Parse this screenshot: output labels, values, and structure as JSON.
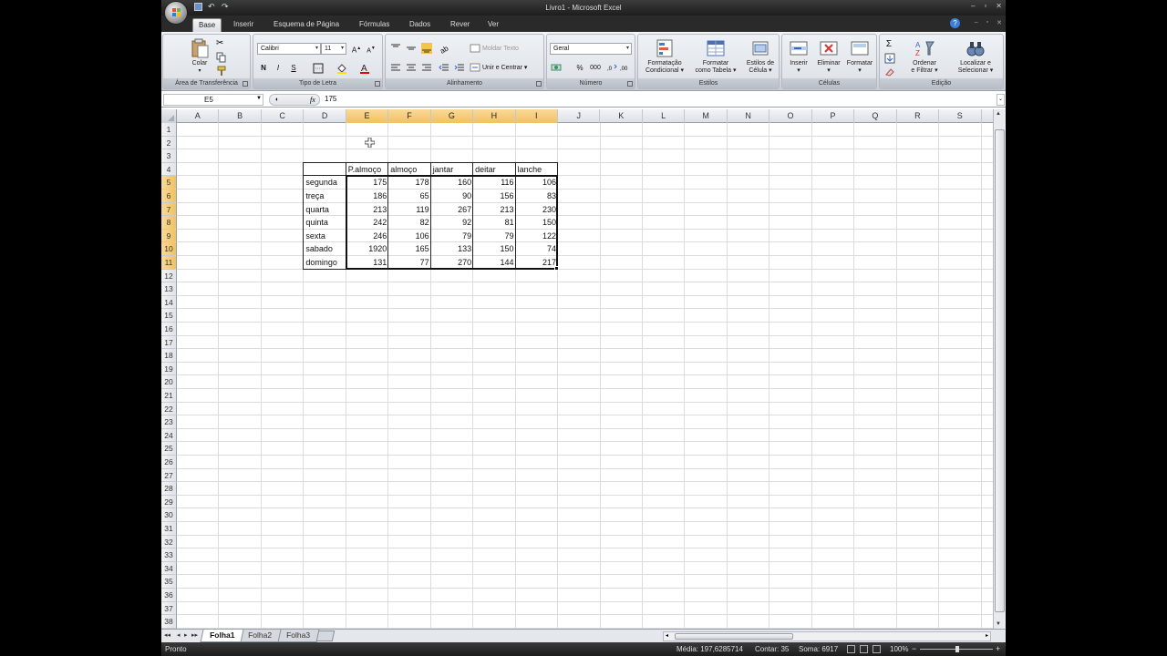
{
  "window": {
    "title": "Livro1 - Microsoft Excel",
    "controls": [
      "–",
      "▫",
      "✕"
    ]
  },
  "ribbon_tabs": [
    "Base",
    "Inserir",
    "Esquema de Página",
    "Fórmulas",
    "Dados",
    "Rever",
    "Ver"
  ],
  "ribbon": {
    "clipboard": {
      "paste_label": "Colar",
      "group_label": "Área de Transferência"
    },
    "font": {
      "font_name": "Calibri",
      "font_size": "11",
      "bold": "N",
      "italic": "I",
      "underline": "S",
      "group_label": "Tipo de Letra"
    },
    "alignment": {
      "wrap_text": "Moldar Texto",
      "merge_center": "Unir e Centrar",
      "group_label": "Alinhamento"
    },
    "number": {
      "format": "Geral",
      "percent": "%",
      "thousands": "000",
      "group_label": "Número"
    },
    "styles": {
      "conditional_1": "Formatação",
      "conditional_2": "Condicional",
      "table_1": "Formatar",
      "table_2": "como Tabela",
      "cell_1": "Estilos de",
      "cell_2": "Célula",
      "group_label": "Estilos"
    },
    "cells": {
      "insert": "Inserir",
      "delete": "Eliminar",
      "format": "Formatar",
      "group_label": "Células"
    },
    "editing": {
      "sort_1": "Ordenar",
      "sort_2": "e Filtrar",
      "find_1": "Localizar e",
      "find_2": "Selecionar",
      "sigma": "Σ",
      "group_label": "Edição"
    }
  },
  "formula_bar": {
    "name_box": "E5",
    "fx": "fx",
    "value": "175"
  },
  "columns": [
    "A",
    "B",
    "C",
    "D",
    "E",
    "F",
    "G",
    "H",
    "I",
    "J",
    "K",
    "L",
    "M",
    "N",
    "O",
    "P",
    "Q",
    "R",
    "S"
  ],
  "selected_columns": [
    "E",
    "F",
    "G",
    "H",
    "I"
  ],
  "row_count": 38,
  "selected_rows": [
    5,
    6,
    7,
    8,
    9,
    10,
    11
  ],
  "table": {
    "headers": [
      "",
      "P.almoço",
      "almoço",
      "jantar",
      "deitar",
      "lanche"
    ],
    "rows": [
      {
        "day": "segunda",
        "values": [
          175,
          178,
          160,
          116,
          106
        ]
      },
      {
        "day": "treça",
        "values": [
          186,
          65,
          90,
          156,
          83
        ]
      },
      {
        "day": "quarta",
        "values": [
          213,
          119,
          267,
          213,
          230
        ]
      },
      {
        "day": "quinta",
        "values": [
          242,
          82,
          92,
          81,
          150
        ]
      },
      {
        "day": "sexta",
        "values": [
          246,
          106,
          79,
          79,
          122
        ]
      },
      {
        "day": "sabado",
        "values": [
          1920,
          165,
          133,
          150,
          74
        ]
      },
      {
        "day": "domingo",
        "values": [
          131,
          77,
          270,
          144,
          217
        ]
      }
    ]
  },
  "sheets": [
    "Folha1",
    "Folha2",
    "Folha3"
  ],
  "active_sheet": "Folha1",
  "status": {
    "ready": "Pronto",
    "average": "Média: 197,6285714",
    "count": "Contar: 35",
    "sum": "Soma: 6917",
    "zoom": "100%",
    "zoom_minus": "−",
    "zoom_plus": "+"
  },
  "colors": {
    "selection_header": "#f1c15f",
    "ribbon_bg": "#dde1e7",
    "chrome_dark": "#1e1e1e"
  }
}
